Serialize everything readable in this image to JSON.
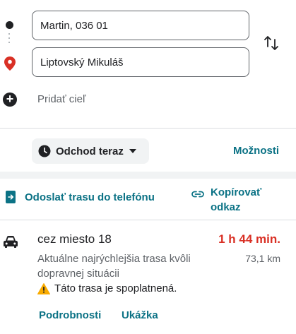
{
  "directions": {
    "origin": {
      "value": "Martin, 036 01"
    },
    "destination": {
      "value": "Liptovský Mikuláš"
    },
    "add_destination_label": "Pridať cieľ",
    "swap_icon": "swap-vertical-icon"
  },
  "departure": {
    "chip_label": "Odchod teraz",
    "options_label": "Možnosti"
  },
  "actions": {
    "send_to_phone_label": "Odoslať trasu do telefónu",
    "copy_link_line1": "Kopírovať",
    "copy_link_line2": "odkaz"
  },
  "route": {
    "title": "cez miesto 18",
    "duration": "1 h 44 min.",
    "distance": "73,1 km",
    "description": "Aktuálne najrýchlejšia trasa kvôli dopravnej situácii",
    "warning": "Táto trasa je spoplatnená.",
    "details_label": "Podrobnosti",
    "preview_label": "Ukážka"
  },
  "colors": {
    "accent_link": "#0b7285",
    "duration_red": "#d93025",
    "pin_red": "#d93025",
    "warning_amber": "#f9ab00"
  }
}
